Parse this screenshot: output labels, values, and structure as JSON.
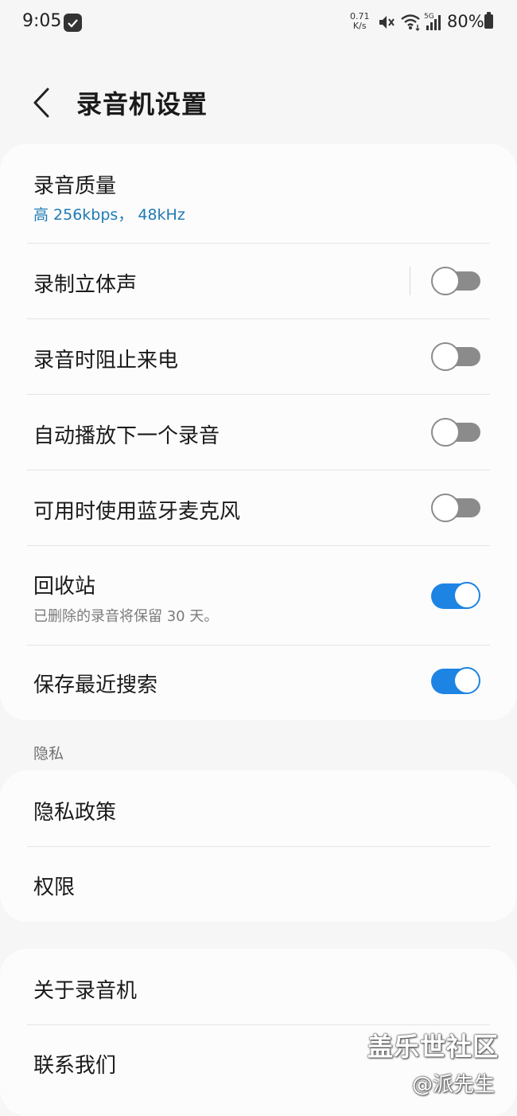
{
  "status_bar": {
    "time": "9:05",
    "net_speed_value": "0.71",
    "net_speed_unit": "K/s",
    "network_type": "5G",
    "battery": "80%"
  },
  "header": {
    "title": "录音机设置"
  },
  "settings": {
    "recording_quality": {
      "label": "录音质量",
      "value": "高 256kbps， 48kHz"
    },
    "stereo": {
      "label": "录制立体声",
      "enabled": false
    },
    "block_calls": {
      "label": "录音时阻止来电",
      "enabled": false
    },
    "autoplay_next": {
      "label": "自动播放下一个录音",
      "enabled": false
    },
    "bluetooth_mic": {
      "label": "可用时使用蓝牙麦克风",
      "enabled": false
    },
    "recycle_bin": {
      "label": "回收站",
      "description": "已删除的录音将保留 30 天。",
      "enabled": true
    },
    "save_recent_searches": {
      "label": "保存最近搜索",
      "enabled": true
    }
  },
  "privacy_section": {
    "label": "隐私",
    "items": [
      "隐私政策",
      "权限"
    ]
  },
  "about_section": {
    "items": [
      "关于录音机",
      "联系我们"
    ]
  },
  "watermark": {
    "main": "盖乐世社区",
    "sub": "@派先生"
  },
  "colors": {
    "accent": "#1e84e3",
    "link": "#1f7ab5",
    "toggle_off": "#8b8b8b",
    "background": "#f6f6f6",
    "card": "#fcfcfc"
  }
}
